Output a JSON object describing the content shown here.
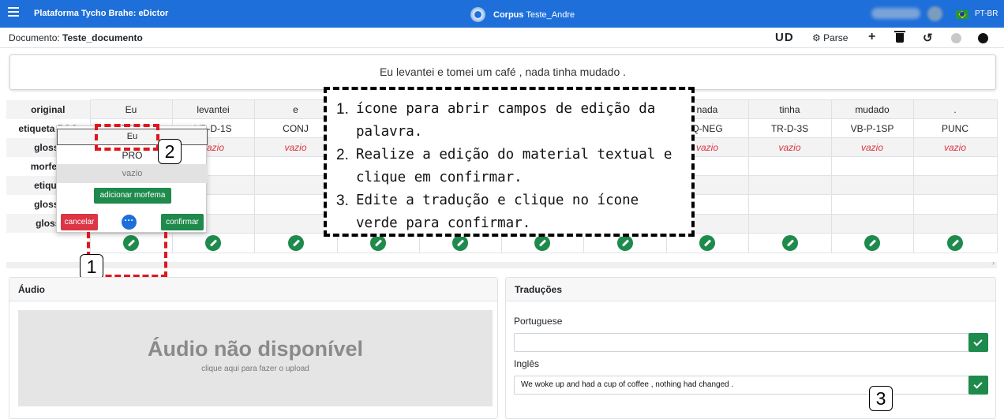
{
  "topbar": {
    "title": "Plataforma Tycho Brahe: eDictor",
    "corpus_label": "Corpus",
    "corpus_name": "Teste_Andre",
    "language": "PT-BR"
  },
  "docbar": {
    "doc_label": "Documento:",
    "doc_name": "Teste_documento",
    "ud_label": "UD",
    "parse_label": "Parse"
  },
  "sentence": "Eu levantei e tomei um café , nada tinha mudado .",
  "gloss_table": {
    "row_labels": [
      "original",
      "etiqueta POS",
      "gloss-",
      "morfem",
      "etique",
      "gloss-",
      "gloss"
    ],
    "words": [
      "Eu",
      "levantei",
      "e",
      "",
      "",
      "",
      "",
      "nada",
      "tinha",
      "mudado",
      "."
    ],
    "pos": [
      "PRO",
      "VB-D-1S",
      "CONJ",
      "",
      "",
      "",
      "",
      "Q-NEG",
      "TR-D-3S",
      "VB-P-1SP",
      "PUNC"
    ],
    "gloss": [
      "vazio",
      "vazio",
      "vazio",
      "",
      "",
      "",
      "",
      "vazio",
      "vazio",
      "vazio",
      "vazio"
    ]
  },
  "popup": {
    "word": "Eu",
    "tag": "PRO",
    "gloss_placeholder": "vazio",
    "add_morpheme": "adicionar morfema",
    "cancel": "cancelar",
    "more": "···",
    "confirm": "confirmar"
  },
  "instructions": {
    "items": [
      {
        "n": "1.",
        "text": "ícone para abrir campos de edição da palavra."
      },
      {
        "n": "2.",
        "text": "Realize a edição do material textual e clique em confirmar."
      },
      {
        "n": "3.",
        "text": "Edite a tradução e clique no ícone verde para confirmar."
      }
    ],
    "markers": [
      "1",
      "2",
      "3"
    ]
  },
  "audio": {
    "title": "Áudio",
    "unavailable": "Áudio não disponível",
    "upload_hint": "clique aqui para fazer o upload"
  },
  "translations": {
    "title": "Traduções",
    "portuguese_label": "Portuguese",
    "portuguese_value": "",
    "english_label": "Inglês",
    "english_value": "We woke up and had a cup of coffee , nothing had changed ."
  },
  "colors": {
    "topbar": "#1e6fd9",
    "success": "#1e8a4c",
    "danger": "#dc3545",
    "annotation": "#e0161d"
  }
}
